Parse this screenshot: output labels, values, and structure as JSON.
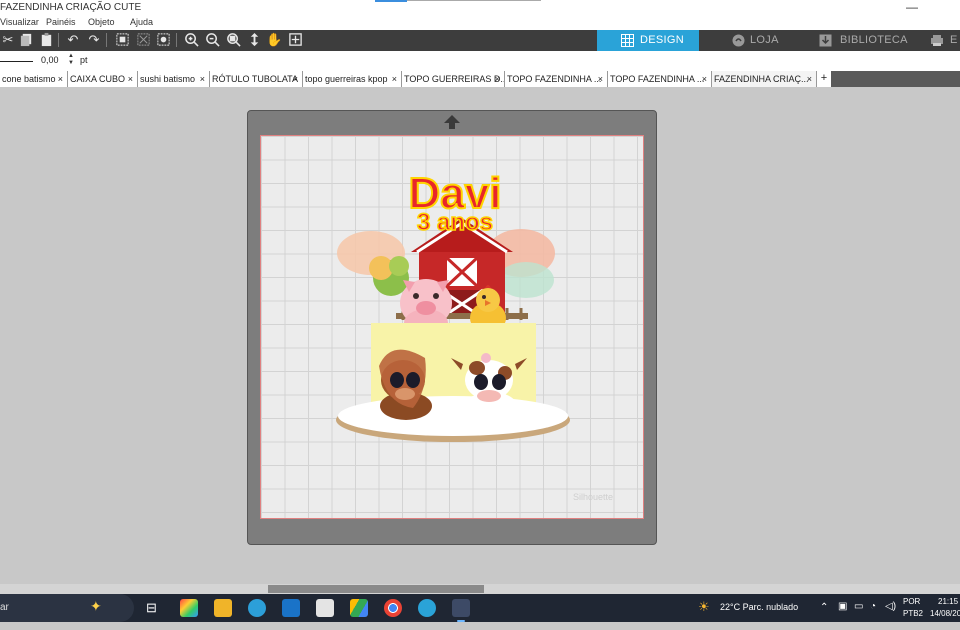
{
  "window": {
    "title": "FAZENDINHA CRIAÇÃO CUTE"
  },
  "menu": [
    "Visualizar",
    "Painéis",
    "Objeto",
    "Ajuda"
  ],
  "nav": {
    "design": "DESIGN",
    "store": "LOJA",
    "library": "BIBLIOTECA",
    "send": "E"
  },
  "props": {
    "line_value": "0,00",
    "unit": "pt"
  },
  "tabs": [
    {
      "label": "cone batismo",
      "active": false
    },
    {
      "label": "CAIXA CUBO",
      "active": false
    },
    {
      "label": "sushi batismo",
      "active": false
    },
    {
      "label": "RÓTULO TUBOLATA",
      "active": false
    },
    {
      "label": "topo guerreiras kpop",
      "active": false
    },
    {
      "label": "TOPO GUERREIRAS D...",
      "active": false
    },
    {
      "label": "TOPO FAZENDINHA ...",
      "active": false
    },
    {
      "label": "TOPO FAZENDINHA ...",
      "active": false
    },
    {
      "label": "FAZENDINHA CRIAÇ...",
      "active": true
    }
  ],
  "tab_close": "×",
  "tab_add": "+",
  "design": {
    "name_text": "Davi",
    "age_text": "3 anos",
    "watermark": "Silhouette"
  },
  "colors": {
    "accent": "#2aa3d8",
    "toolbar": "#3d3d3d",
    "title_red": "#e8262a",
    "title_yellow": "#ffd400"
  },
  "taskbar": {
    "search_text": "ar",
    "weather": "22°C  Parc. nublado",
    "lang_top": "POR",
    "lang_bottom": "PTB2",
    "time": "21:15",
    "date": "14/08/20"
  }
}
